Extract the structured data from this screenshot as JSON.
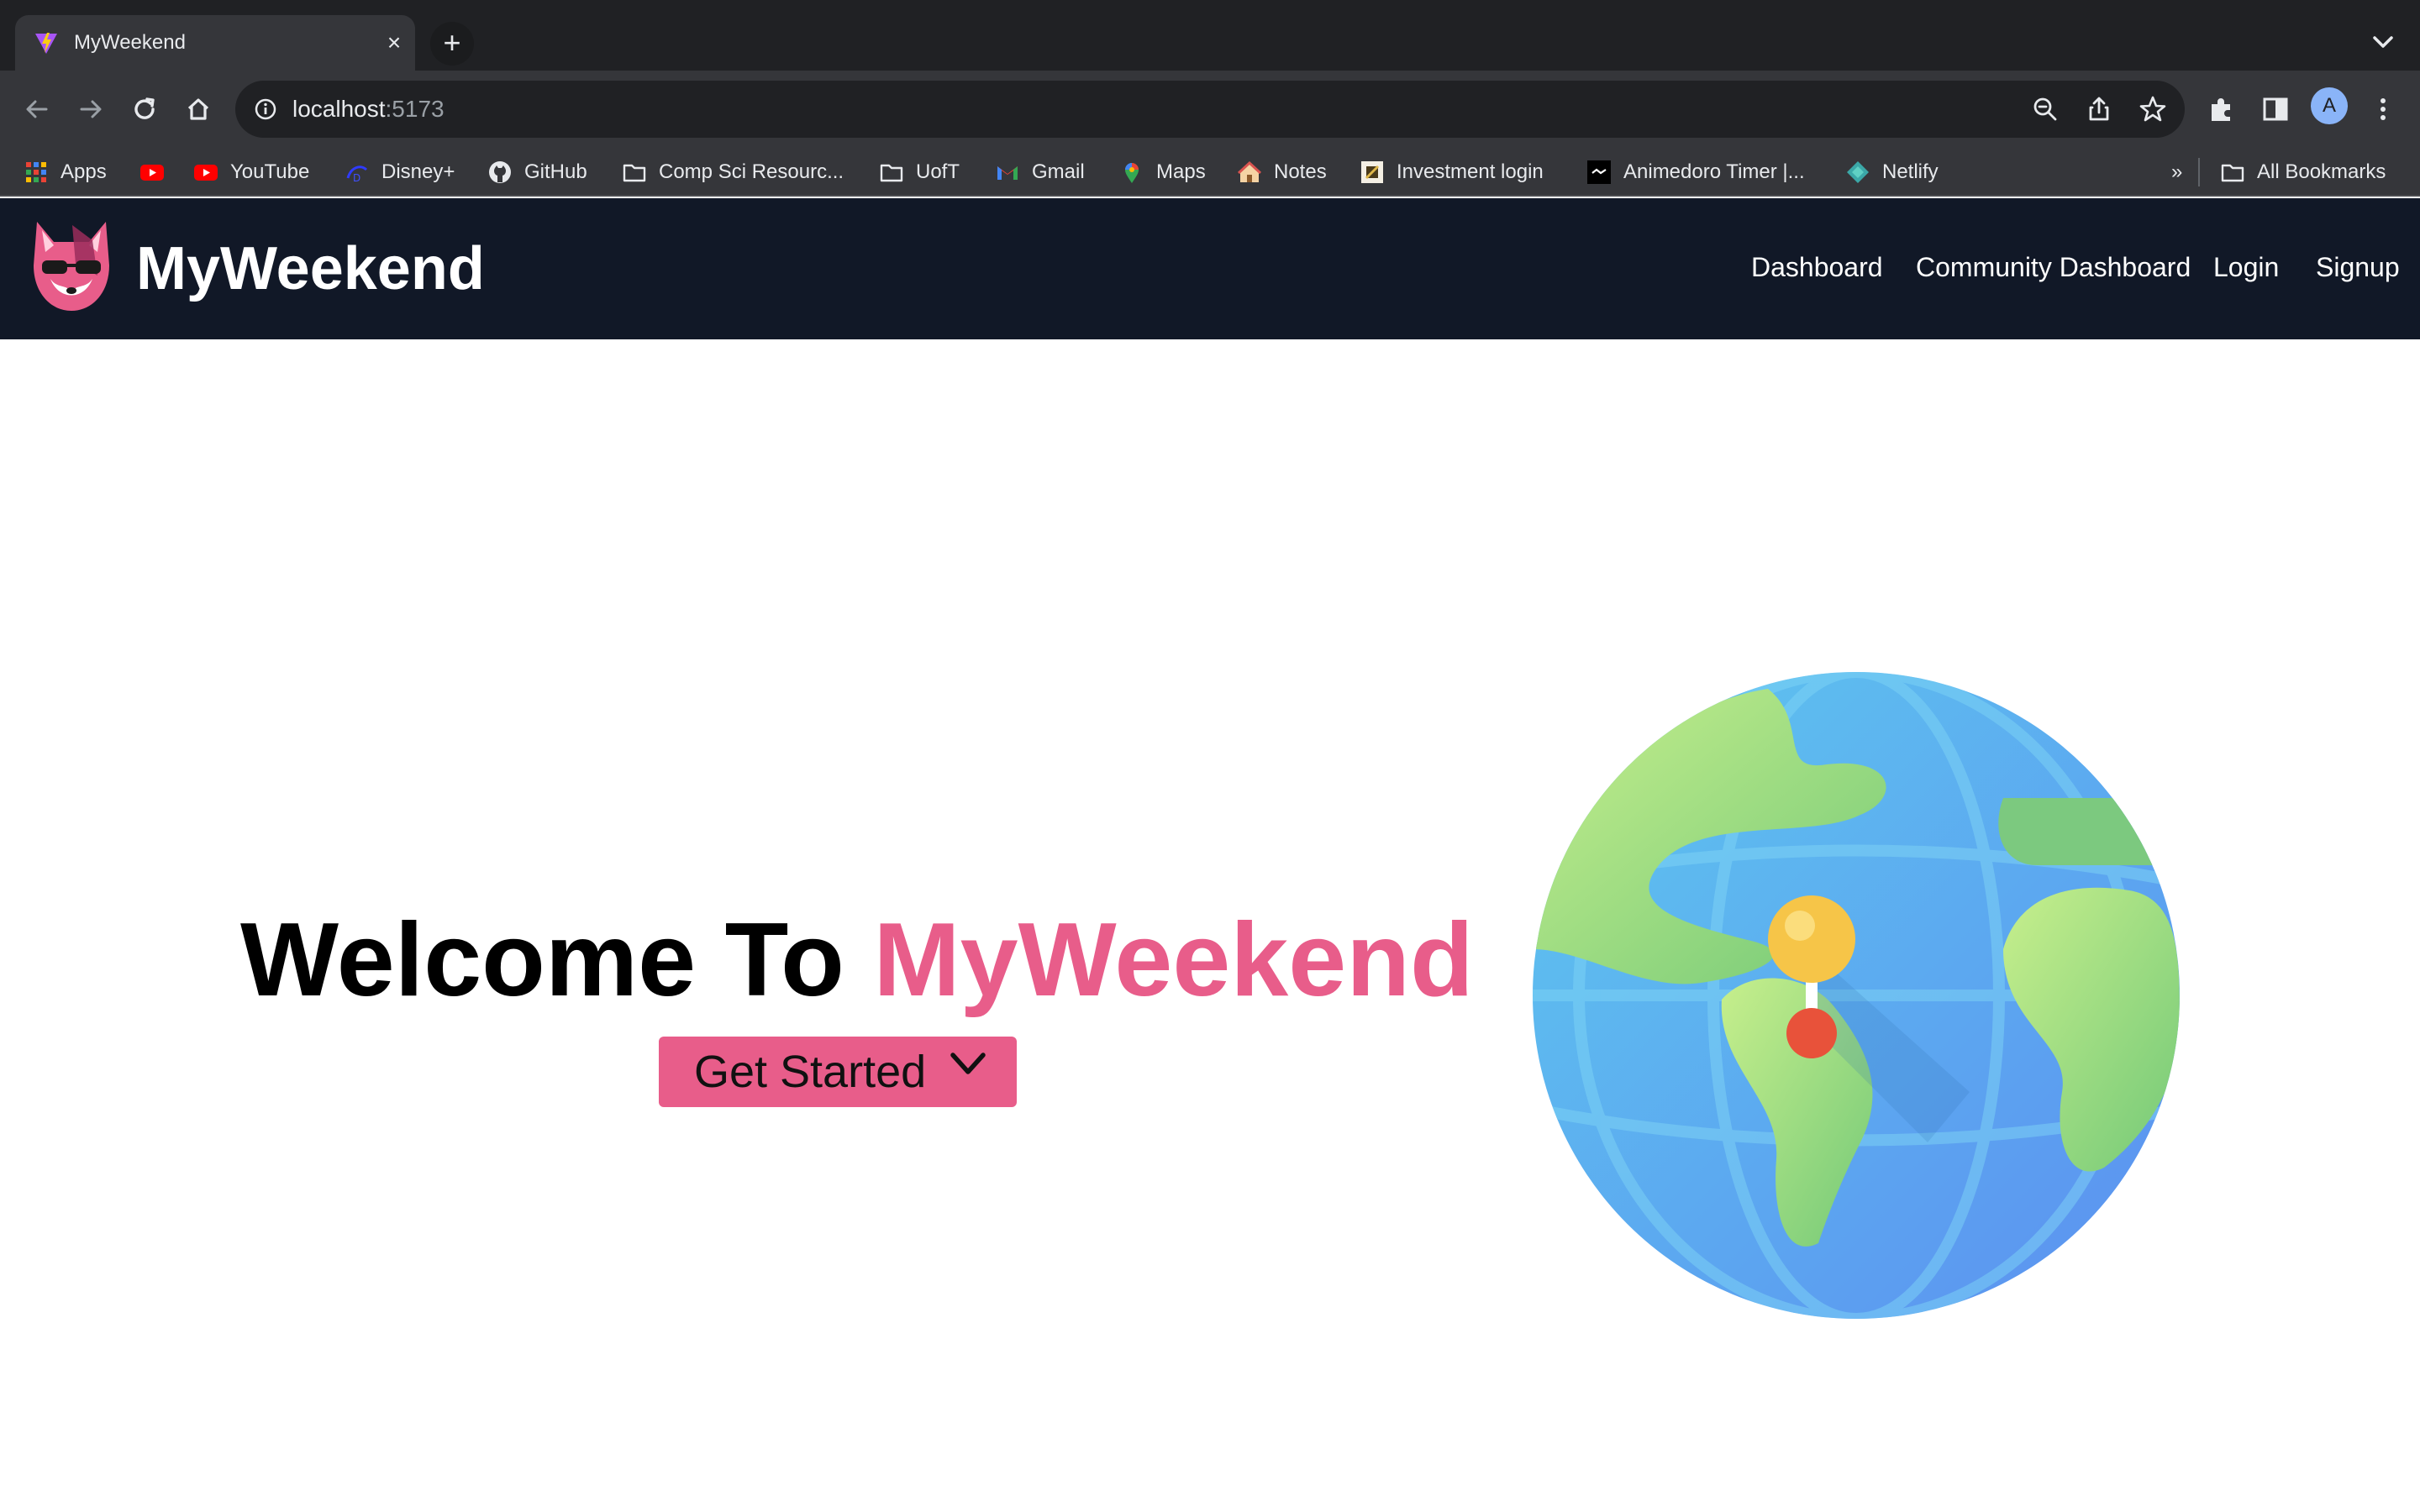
{
  "browser": {
    "tab_title": "MyWeekend",
    "tab_close": "×",
    "new_tab": "+",
    "url_host": "localhost",
    "url_port": ":5173",
    "profile_initial": "A",
    "overflow_chevron": "»"
  },
  "bookmarks": [
    {
      "label": "Apps",
      "icon": "apps-grid-icon"
    },
    {
      "label": "",
      "icon": "youtube-icon"
    },
    {
      "label": "YouTube",
      "icon": "youtube-icon"
    },
    {
      "label": "Disney+",
      "icon": "disney-icon"
    },
    {
      "label": "GitHub",
      "icon": "github-icon"
    },
    {
      "label": "Comp Sci Resourc...",
      "icon": "folder-icon"
    },
    {
      "label": "UofT",
      "icon": "folder-icon"
    },
    {
      "label": "Gmail",
      "icon": "gmail-icon"
    },
    {
      "label": "Maps",
      "icon": "maps-icon"
    },
    {
      "label": "Notes",
      "icon": "notes-icon"
    },
    {
      "label": "Investment login",
      "icon": "investment-icon"
    },
    {
      "label": "Animedoro Timer |...",
      "icon": "animedoro-icon"
    },
    {
      "label": "Netlify",
      "icon": "netlify-icon"
    }
  ],
  "all_bookmarks": "All Bookmarks",
  "app": {
    "brand": "MyWeekend",
    "nav": [
      "Dashboard",
      "Community Dashboard",
      "Login",
      "Signup"
    ],
    "hero_prefix": "Welcome To ",
    "hero_accent": "MyWeekend",
    "cta_label": "Get Started"
  },
  "colors": {
    "accent": "#e85d8a",
    "navbar": "#111827",
    "browser_dark": "#202124",
    "browser_toolbar": "#35363a"
  }
}
